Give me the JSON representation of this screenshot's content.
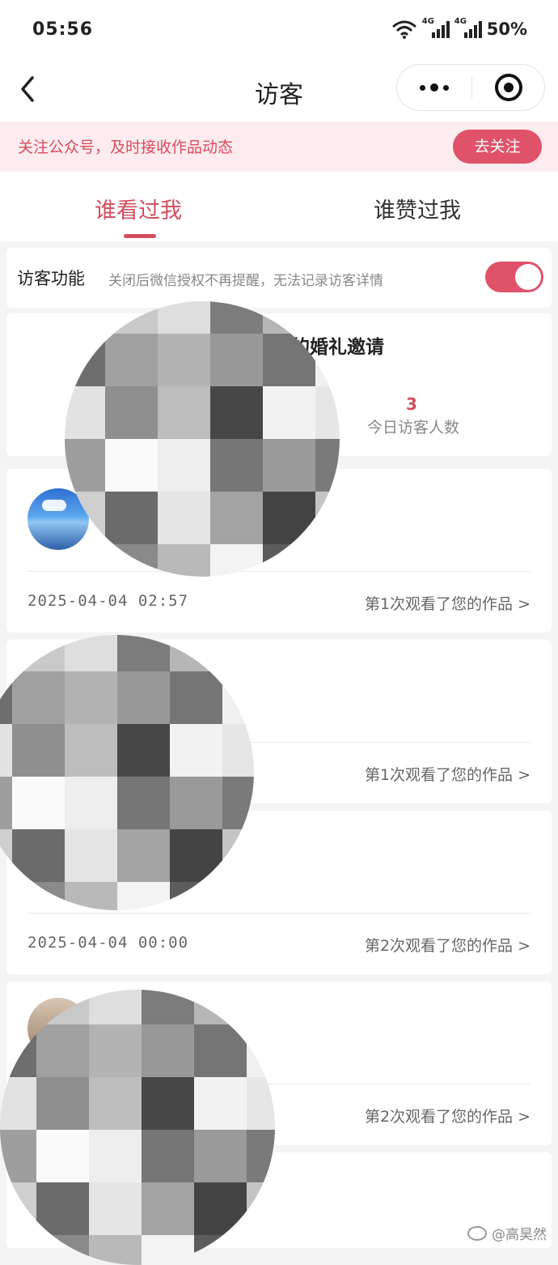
{
  "status_bar": {
    "time": "05:56",
    "network_1": "4G",
    "network_2": "4G",
    "battery": "50%"
  },
  "nav": {
    "title": "访客",
    "back_icon": "chevron-left-icon",
    "more_icon": "more-dots-icon",
    "close_icon": "target-close-icon"
  },
  "banner": {
    "text": "关注公众号，及时接收作品动态",
    "button": "去关注"
  },
  "tabs": [
    {
      "label": "谁看过我",
      "active": true
    },
    {
      "label": "谁赞过我",
      "active": false
    }
  ],
  "visitor_feature": {
    "label": "访客功能",
    "description": "关闭后微信授权不再提醒，无法记录访客详情",
    "enabled": true
  },
  "work": {
    "title": "的婚礼邀请",
    "today_visitors": "3",
    "today_visitors_label": "今日访客人数"
  },
  "visitors": [
    {
      "time": "2025-04-04 02:57",
      "views": "第1次观看了您的作品 >"
    },
    {
      "time": "",
      "views": "第1次观看了您的作品 >"
    },
    {
      "time": "2025-04-04 00:00",
      "views": "第2次观看了您的作品 >"
    },
    {
      "time": "",
      "views": "第2次观看了您的作品 >"
    }
  ],
  "watermark": "@高昊然",
  "colors": {
    "accent": "#e0526a",
    "banner_bg": "#fdecef",
    "page_bg": "#f4f4f4"
  }
}
